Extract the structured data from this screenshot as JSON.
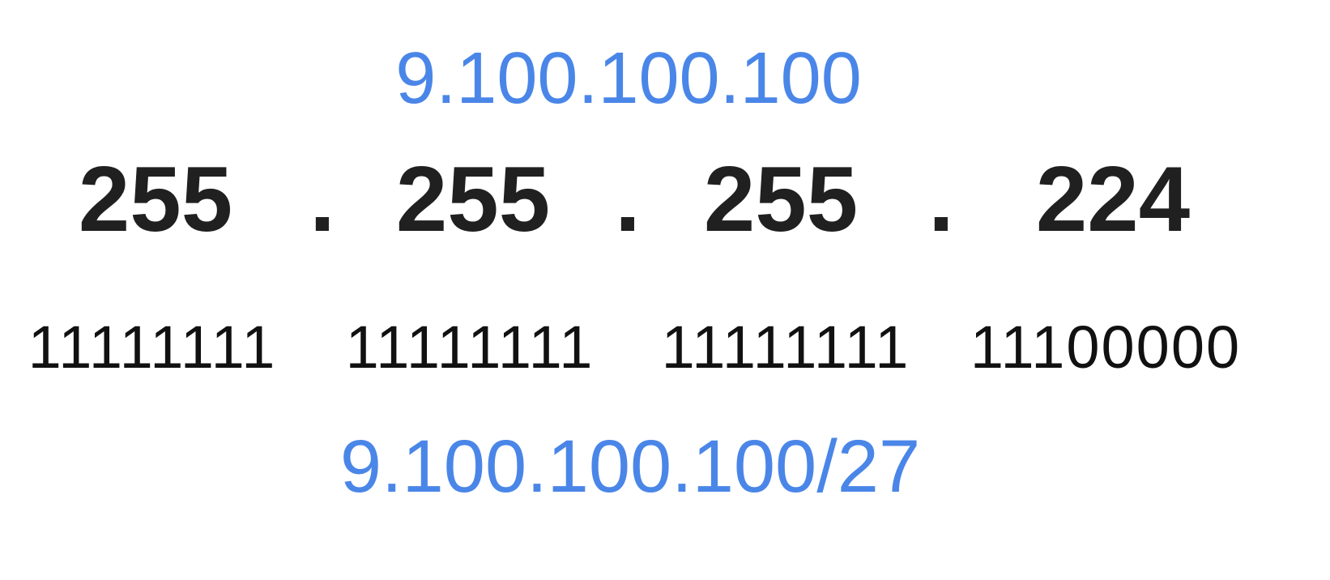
{
  "ip_address": "9.100.100.100",
  "subnet_mask": {
    "octets": [
      "255",
      "255",
      "255",
      "224"
    ],
    "separator": "."
  },
  "binary_octets": [
    "11111111",
    "11111111",
    "11111111",
    "11100000"
  ],
  "cidr_notation": "9.100.100.100/27",
  "colors": {
    "accent": "#4a86e8",
    "text": "#202020"
  }
}
